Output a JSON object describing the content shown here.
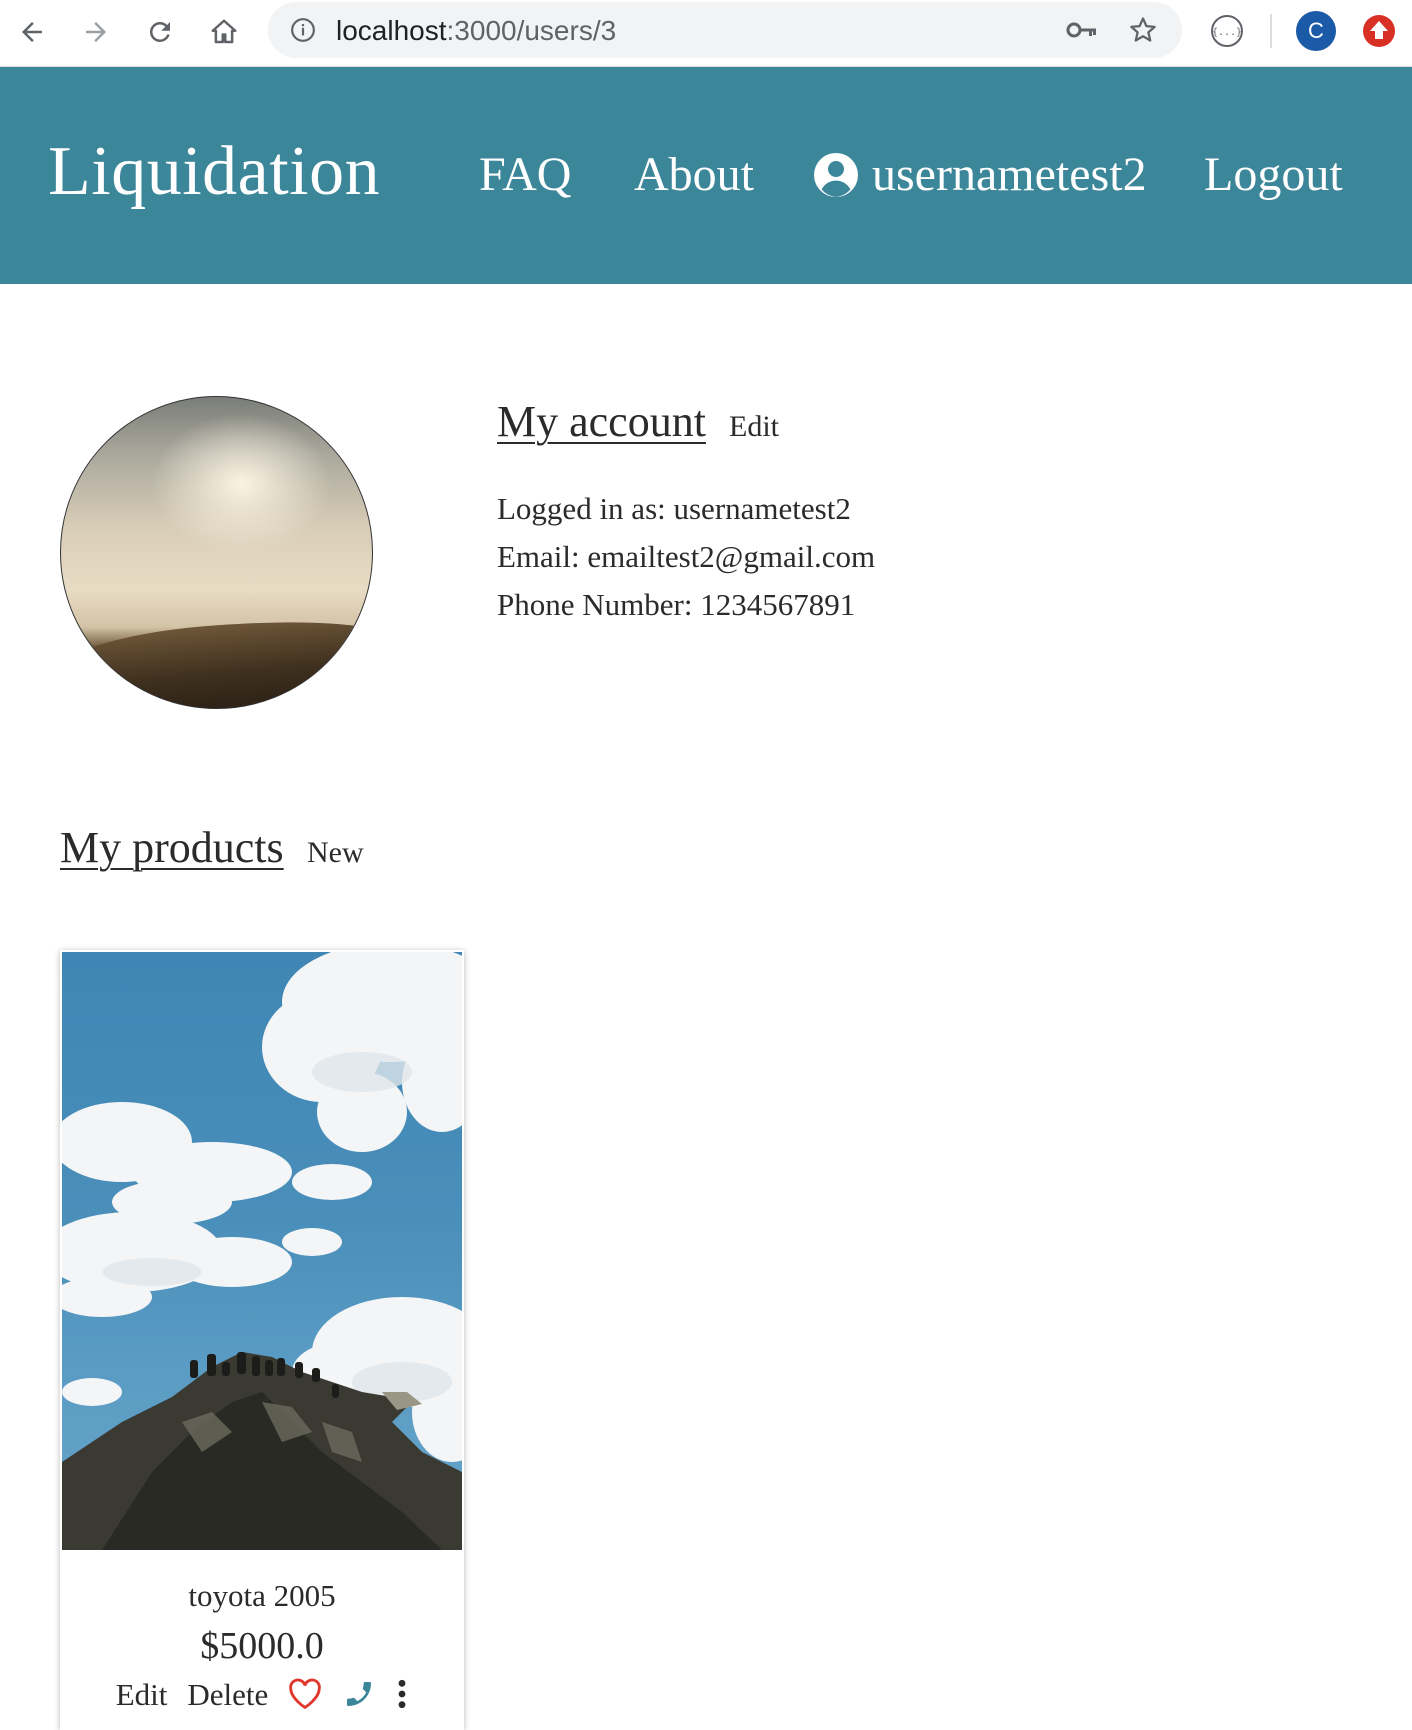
{
  "browser": {
    "url_host": "localhost",
    "url_path": ":3000/users/3",
    "profile_initial": "C",
    "icons": [
      "back-icon",
      "forward-icon",
      "reload-icon",
      "home-icon",
      "info-icon",
      "key-icon",
      "star-icon",
      "extension-icon",
      "update-icon"
    ]
  },
  "navbar": {
    "brand": "Liquidation",
    "links": {
      "faq": "FAQ",
      "about": "About",
      "username": "usernametest2",
      "logout": "Logout"
    },
    "background": "#3b8699"
  },
  "account": {
    "title": "My account",
    "edit_label": "Edit",
    "logged_in": "Logged in as: usernametest2",
    "email": "Email: emailtest2@gmail.com",
    "phone": "Phone Number: 1234567891"
  },
  "products": {
    "title": "My products",
    "new_label": "New",
    "items": [
      {
        "name": "toyota 2005",
        "price": "$5000.0",
        "edit_label": "Edit",
        "delete_label": "Delete"
      }
    ]
  },
  "colors": {
    "heart": "#e0372b",
    "phone": "#3b8699",
    "text": "#2b2b2b"
  }
}
